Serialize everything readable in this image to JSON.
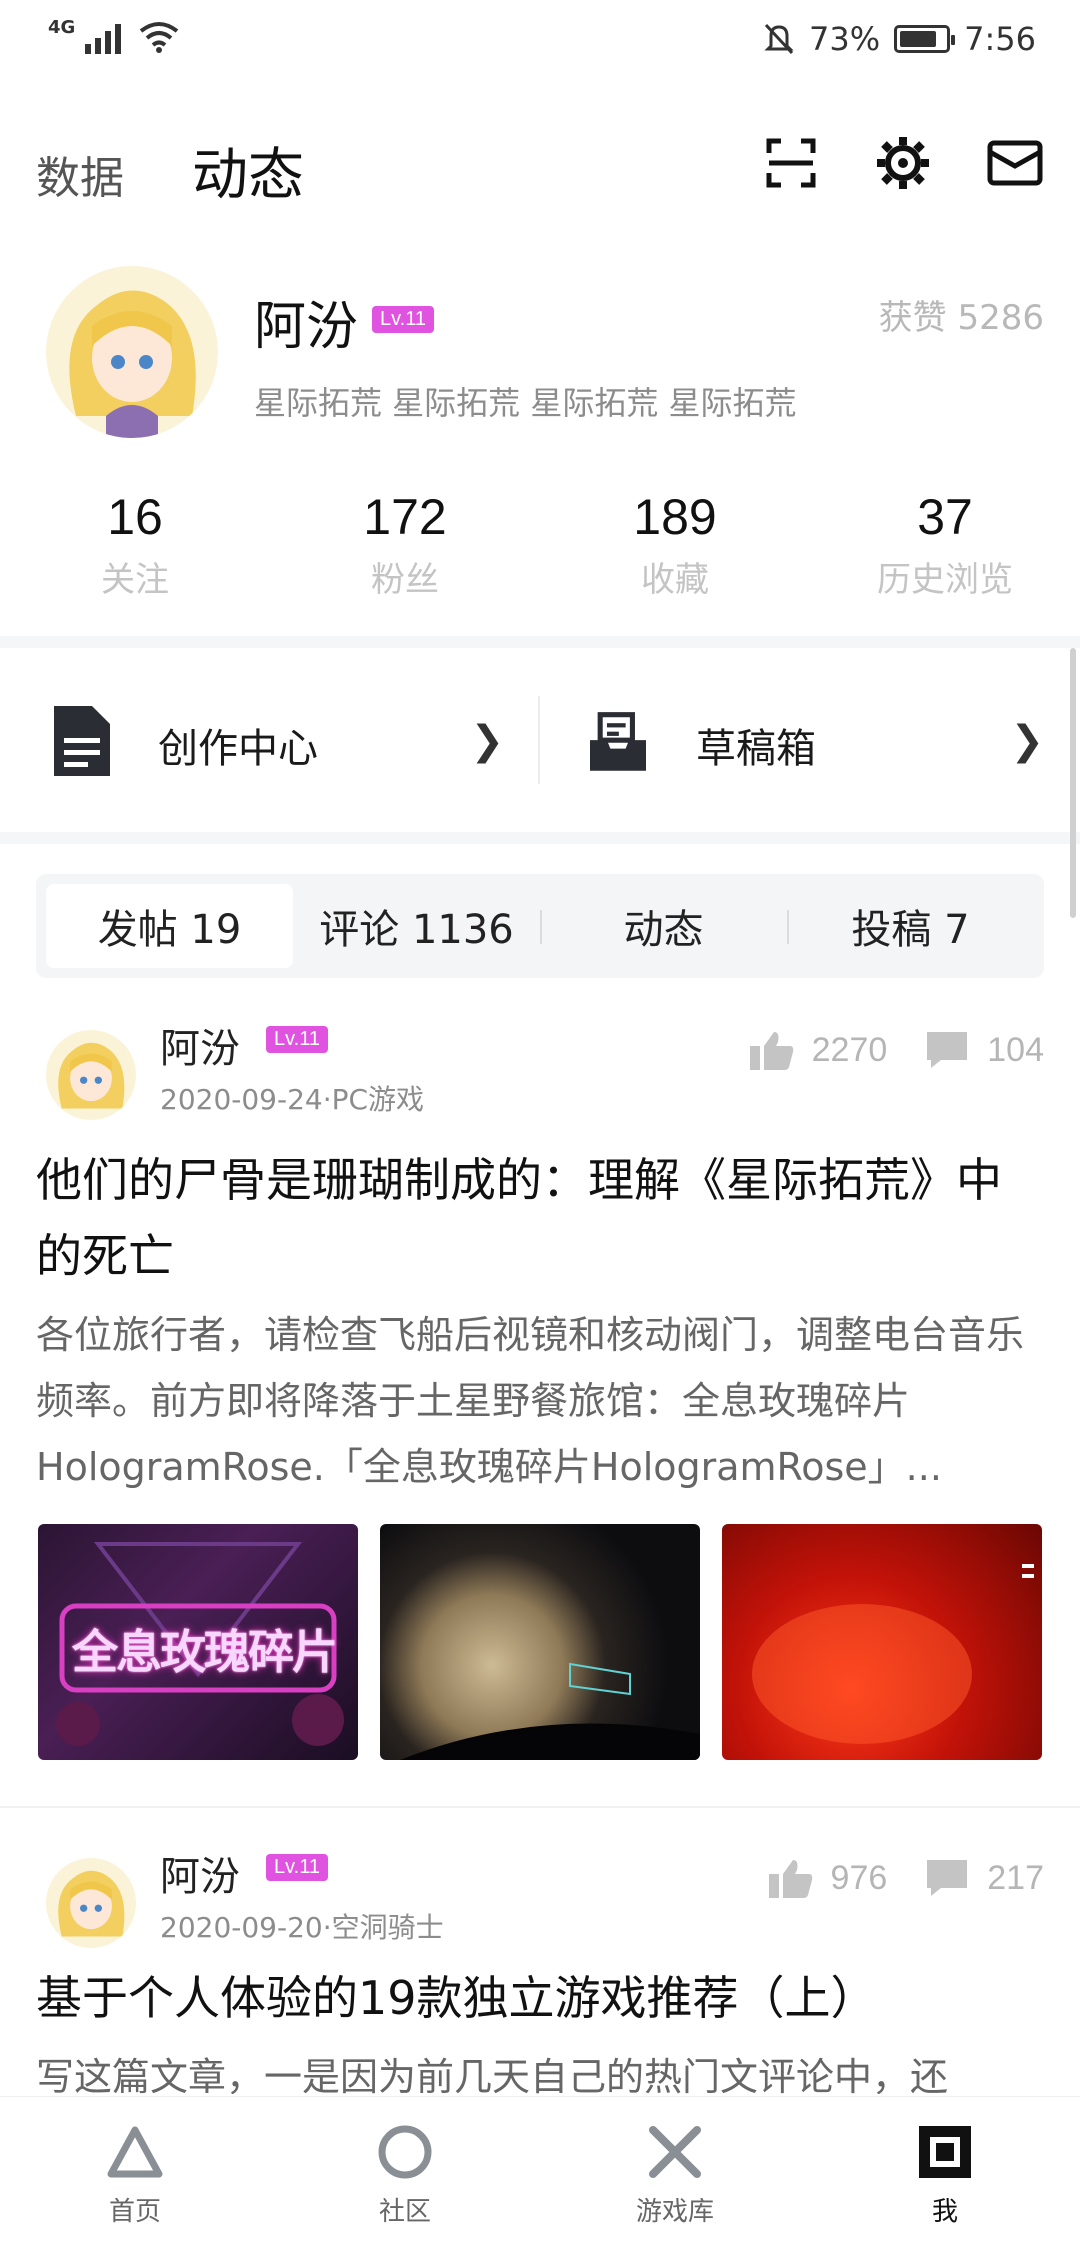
{
  "status_bar": {
    "network": "4G",
    "battery_percent": "73%",
    "time": "7:56"
  },
  "header": {
    "tab_data": "数据",
    "tab_dynamic": "动态"
  },
  "profile": {
    "name": "阿汾",
    "level": "Lv.11",
    "likes": "获赞 5286",
    "signature": "星际拓荒 星际拓荒 星际拓荒 星际拓荒"
  },
  "stats": [
    {
      "value": "16",
      "label": "关注"
    },
    {
      "value": "172",
      "label": "粉丝"
    },
    {
      "value": "189",
      "label": "收藏"
    },
    {
      "value": "37",
      "label": "历史浏览"
    }
  ],
  "quick": {
    "creation": "创作中心",
    "drafts": "草稿箱"
  },
  "segments": [
    {
      "label": "发帖 19"
    },
    {
      "label": "评论 1136"
    },
    {
      "label": "动态"
    },
    {
      "label": "投稿 7"
    }
  ],
  "posts": [
    {
      "author": "阿汾",
      "level": "Lv.11",
      "meta": "2020-09-24·PC游戏",
      "likes": "2270",
      "comments": "104",
      "title": "他们的尸骨是珊瑚制成的：理解《星际拓荒》中的死亡",
      "body": "各位旅行者，请检查飞船后视镜和核动阀门，调整电台音乐频率。前方即将降落于土星野餐旅馆：全息玫瑰碎片HologramRose.「全息玫瑰碎片HologramRose」...",
      "thumb_text": "全息玫瑰碎片"
    },
    {
      "author": "阿汾",
      "level": "Lv.11",
      "meta": "2020-09-20·空洞骑士",
      "likes": "976",
      "comments": "217",
      "title": "基于个人体验的19款独立游戏推荐（上）",
      "body": "写这篇文章，一是因为前几天自己的热门文评论中，还"
    }
  ],
  "bottom_nav": [
    {
      "label": "首页",
      "icon": "triangle-icon"
    },
    {
      "label": "社区",
      "icon": "circle-icon"
    },
    {
      "label": "游戏库",
      "icon": "cross-icon"
    },
    {
      "label": "我",
      "icon": "square-icon"
    }
  ]
}
